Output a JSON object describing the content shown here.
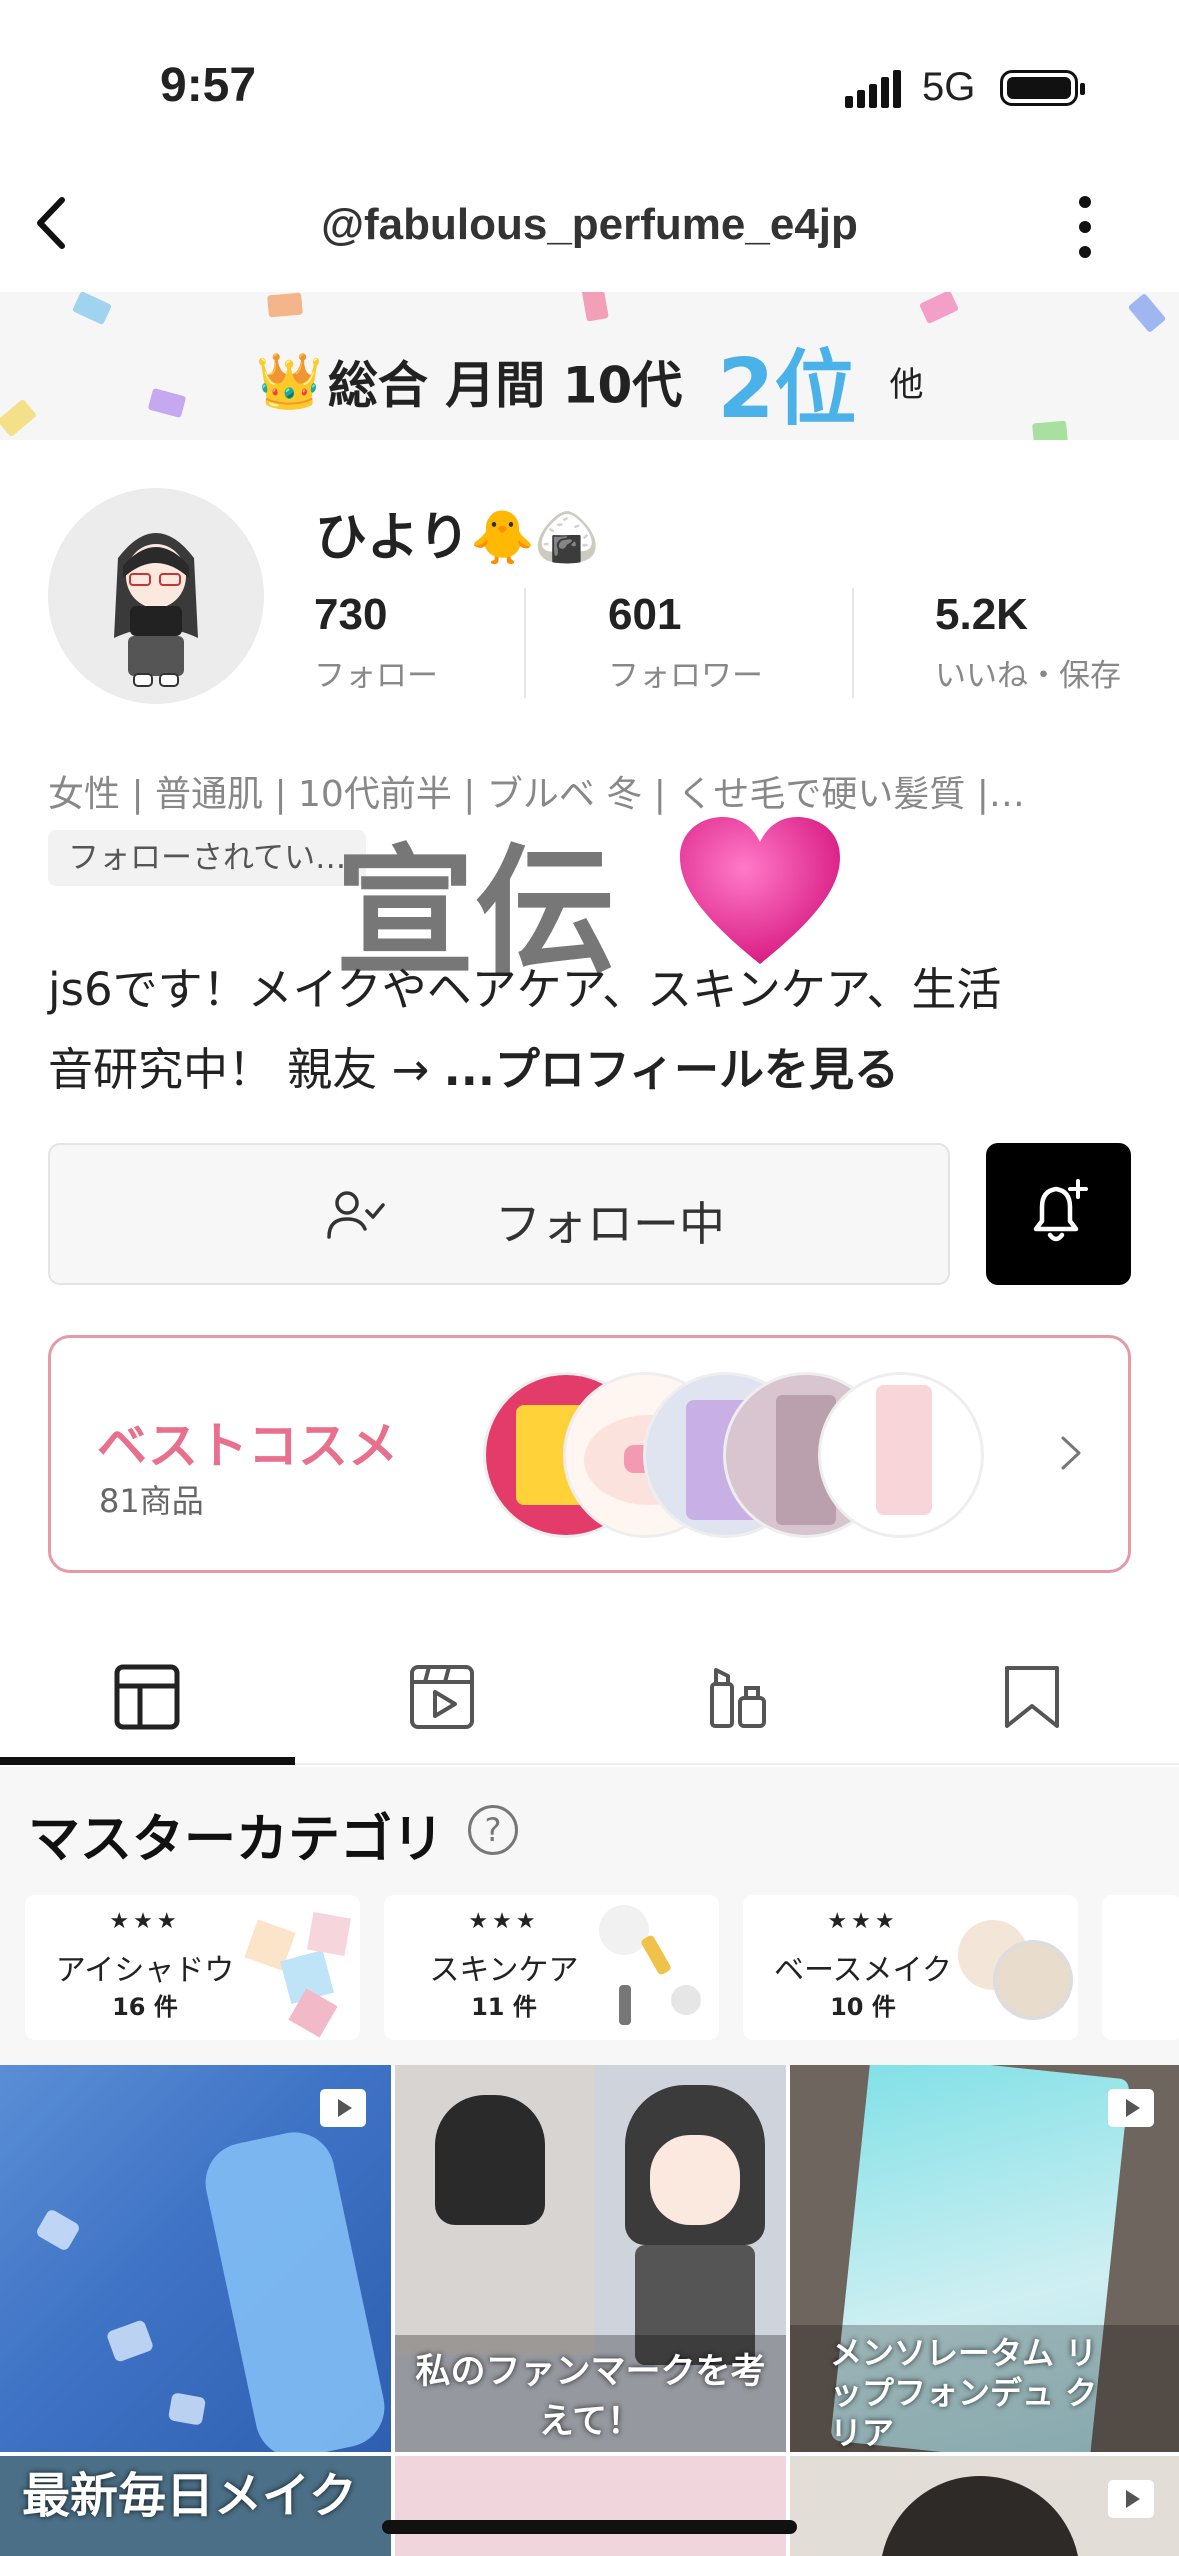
{
  "status": {
    "time": "9:57",
    "network": "5G"
  },
  "nav": {
    "handle": "@fabulous_perfume_e4jp"
  },
  "banner": {
    "crown": "👑",
    "label": "総合 月間 10代",
    "rank": "2位",
    "other": "他"
  },
  "profile": {
    "name": "ひより🐥🍙",
    "stats": [
      {
        "value": "730",
        "label": "フォロー"
      },
      {
        "value": "601",
        "label": "フォロワー"
      },
      {
        "value": "5.2K",
        "label": "いいね・保存"
      }
    ],
    "attributes": "女性 | 普通肌 | 10代前半 | ブルベ 冬 | くせ毛で硬い髪質 |…",
    "followed_tag": "フォローされてい…",
    "promo_text": "宣伝",
    "bio_line1": "js6です！メイクやヘアケア、スキンケア、生活",
    "bio_line2": "音研究中！ 親友 → ",
    "bio_more": "...プロフィールを見る"
  },
  "actions": {
    "follow_label": "フォロー中"
  },
  "best_cosme": {
    "title": "ベストコスメ",
    "count": "81商品"
  },
  "master_category": {
    "heading": "マスターカテゴリ",
    "help": "?",
    "cards": [
      {
        "stars": "★★★",
        "name": "アイシャドウ",
        "count": "16 件"
      },
      {
        "stars": "★★★",
        "name": "スキンケア",
        "count": "11 件"
      },
      {
        "stars": "★★★",
        "name": "ベースメイク",
        "count": "10 件"
      }
    ]
  },
  "posts": [
    {
      "caption": ""
    },
    {
      "caption": "私のファンマークを考えて！"
    },
    {
      "caption": "メンソレータム リップフォンデュ クリア"
    },
    {
      "caption": "最新毎日メイク"
    }
  ],
  "colors": {
    "rank": "#4ab2e8",
    "best_title": "#e8708c",
    "best_border": "#e59aa6"
  }
}
